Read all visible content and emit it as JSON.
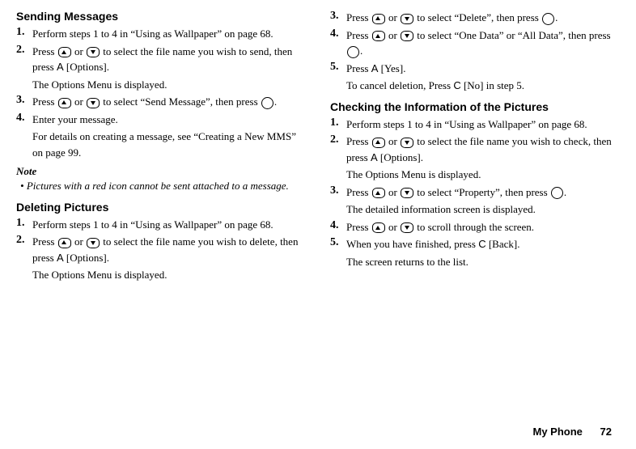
{
  "left": {
    "h1": "Sending Messages",
    "s1": {
      "n": "1.",
      "t": "Perform steps 1 to 4 in “Using as Wallpaper” on page 68."
    },
    "s2": {
      "n": "2.",
      "t_a": "Press ",
      "t_b": " or ",
      "t_c": " to select the file name you wish to send, then press ",
      "options_letter": "A",
      "t_d": " [Options].",
      "sub": "The Options Menu is displayed."
    },
    "s3": {
      "n": "3.",
      "t_a": "Press ",
      "t_b": " or ",
      "t_c": " to select “Send Message”, then press ",
      "t_d": "."
    },
    "s4": {
      "n": "4.",
      "t": "Enter your message.",
      "sub": "For details on creating a message, see “Creating a New MMS” on page 99."
    },
    "note": {
      "head": "Note",
      "bullet": "•",
      "body": "Pictures with a red icon cannot be sent attached to a message."
    },
    "h2": "Deleting Pictures",
    "d1": {
      "n": "1.",
      "t": "Perform steps 1 to 4 in “Using as Wallpaper” on page 68."
    },
    "d2": {
      "n": "2.",
      "t_a": "Press ",
      "t_b": " or ",
      "t_c": " to select the file name you wish to delete, then press ",
      "options_letter": "A",
      "t_d": " [Options].",
      "sub": "The Options Menu is displayed."
    }
  },
  "right": {
    "d3": {
      "n": "3.",
      "t_a": "Press ",
      "t_b": " or ",
      "t_c": " to select “Delete”, then press ",
      "t_d": "."
    },
    "d4": {
      "n": "4.",
      "t_a": "Press ",
      "t_b": " or ",
      "t_c": " to select “One Data” or “All Data”, then press ",
      "t_d": "."
    },
    "d5": {
      "n": "5.",
      "t_a": "Press ",
      "yes_letter": "A",
      "t_b": " [Yes].",
      "sub_a": "To cancel deletion, Press ",
      "no_letter": "C",
      "sub_b": " [No] in step 5."
    },
    "h3": "Checking the Information of the Pictures",
    "c1": {
      "n": "1.",
      "t": "Perform steps 1 to 4 in “Using as Wallpaper” on page 68."
    },
    "c2": {
      "n": "2.",
      "t_a": "Press ",
      "t_b": " or ",
      "t_c": " to select the file name you wish to check, then press ",
      "options_letter": "A",
      "t_d": " [Options].",
      "sub": "The Options Menu is displayed."
    },
    "c3": {
      "n": "3.",
      "t_a": "Press ",
      "t_b": " or ",
      "t_c": " to select “Property”, then press ",
      "t_d": ".",
      "sub": "The detailed information screen is displayed."
    },
    "c4": {
      "n": "4.",
      "t_a": "Press ",
      "t_b": " or ",
      "t_c": " to scroll through the screen."
    },
    "c5": {
      "n": "5.",
      "t_a": "When you have finished, press ",
      "back_letter": "C",
      "t_b": " [Back].",
      "sub": "The screen returns to the list."
    }
  },
  "footer": {
    "section": "My Phone",
    "page": "72"
  }
}
